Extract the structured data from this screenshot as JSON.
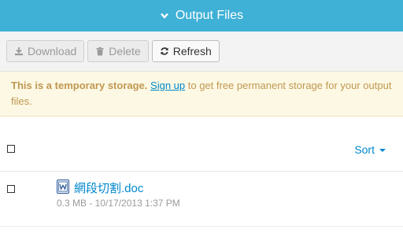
{
  "header": {
    "title": "Output Files",
    "icon": "chevron-down-icon"
  },
  "toolbar": {
    "download_label": "Download",
    "delete_label": "Delete",
    "refresh_label": "Refresh"
  },
  "notice": {
    "bold": "This is a temporary storage.",
    "link": "Sign up",
    "rest": " to get free permanent storage for your output files."
  },
  "list": {
    "sort_label": "Sort",
    "files": [
      {
        "name": "網段切割.doc",
        "meta": "0.3 MB - 10/17/2013 1:37 PM",
        "icon": "word-doc-icon"
      }
    ]
  },
  "colors": {
    "header": "#3fb0d6",
    "link": "#0088cc",
    "notice_bg": "#fcf8e3",
    "notice_text": "#c09853"
  }
}
